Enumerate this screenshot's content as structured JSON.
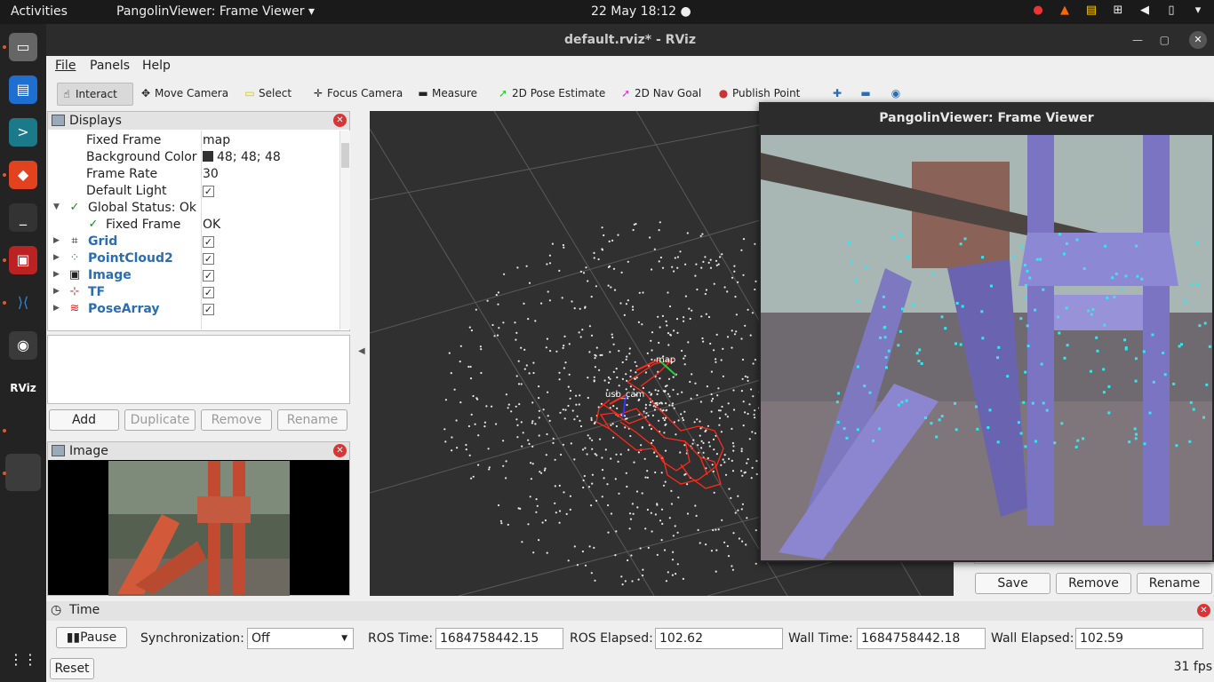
{
  "topbar": {
    "activities": "Activities",
    "app": "PangolinViewer: Frame Viewer ▾",
    "clock": "22 May  18:12  ●"
  },
  "window": {
    "title": "default.rviz* - RViz"
  },
  "menu": {
    "file": "File",
    "panels": "Panels",
    "help": "Help"
  },
  "tools": [
    {
      "label": "Interact",
      "icon": "hand-icon"
    },
    {
      "label": "Move Camera",
      "icon": "move-camera-icon"
    },
    {
      "label": "Select",
      "icon": "select-box-icon"
    },
    {
      "label": "Focus Camera",
      "icon": "focus-icon"
    },
    {
      "label": "Measure",
      "icon": "ruler-icon"
    },
    {
      "label": "2D Pose Estimate",
      "icon": "green-arrow-icon"
    },
    {
      "label": "2D Nav Goal",
      "icon": "pink-arrow-icon"
    },
    {
      "label": "Publish Point",
      "icon": "pin-icon"
    }
  ],
  "displays": {
    "title": "Displays",
    "rows": [
      {
        "key": "Fixed Frame",
        "value": "map"
      },
      {
        "key": "Background Color",
        "value": "48; 48; 48"
      },
      {
        "key": "Frame Rate",
        "value": "30"
      },
      {
        "key": "Default Light",
        "value": ""
      },
      {
        "key": "Global Status: Ok",
        "value": ""
      },
      {
        "key": "Fixed Frame",
        "value": "OK"
      },
      {
        "key": "Grid",
        "value": ""
      },
      {
        "key": "PointCloud2",
        "value": ""
      },
      {
        "key": "Image",
        "value": ""
      },
      {
        "key": "TF",
        "value": ""
      },
      {
        "key": "PoseArray",
        "value": ""
      }
    ],
    "buttons": {
      "add": "Add",
      "duplicate": "Duplicate",
      "remove": "Remove",
      "rename": "Rename"
    }
  },
  "image_panel": {
    "title": "Image"
  },
  "view3d": {
    "tf_label_map": "map",
    "tf_label_cam": "usb_cam"
  },
  "pangolin": {
    "title": "PangolinViewer: Frame Viewer"
  },
  "right_buttons": {
    "save": "Save",
    "remove": "Remove",
    "rename": "Rename"
  },
  "time": {
    "title": "Time",
    "pause": "Pause",
    "sync_label": "Synchronization:",
    "sync_value": "Off",
    "ros_time_label": "ROS Time:",
    "ros_time": "1684758442.15",
    "ros_elapsed_label": "ROS Elapsed:",
    "ros_elapsed": "102.62",
    "wall_time_label": "Wall Time:",
    "wall_time": "1684758442.18",
    "wall_elapsed_label": "Wall Elapsed:",
    "wall_elapsed": "102.59",
    "reset": "Reset",
    "fps": "31 fps"
  }
}
